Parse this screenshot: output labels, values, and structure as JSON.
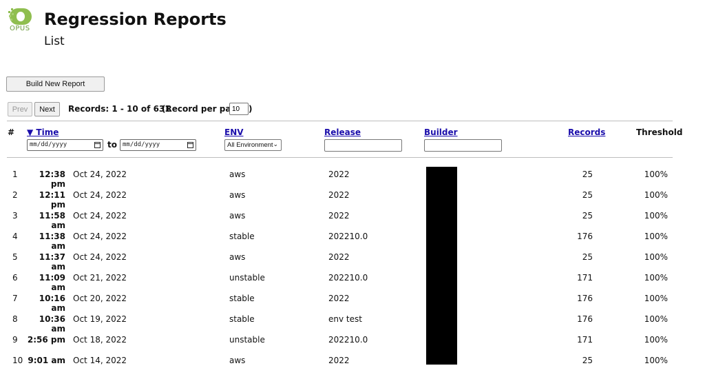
{
  "brand": {
    "logo_text": "OPUS",
    "accent": "#6a9a3a"
  },
  "page": {
    "title": "Regression Reports",
    "subtitle": "List"
  },
  "actions": {
    "build_label": "Build New Report"
  },
  "pagination": {
    "prev_label": "Prev",
    "next_label": "Next",
    "records_label": "Records: 1 - 10 of 631",
    "per_page_label": "(Record per page:",
    "per_page_value": "10",
    "per_page_close": ")"
  },
  "table": {
    "headers": {
      "num": "#",
      "time": "▼ Time",
      "env": "ENV",
      "release": "Release",
      "builder": "Builder",
      "records": "Records",
      "threshold": "Threshold"
    },
    "filters": {
      "date_from_placeholder": "mm/dd/yyyy",
      "to_label": "to",
      "date_to_placeholder": "mm/dd/yyyy",
      "env_selected": "All Environment",
      "release_value": "",
      "builder_value": ""
    },
    "rows": [
      {
        "num": "1",
        "time": "12:38 pm",
        "date": "Oct 24, 2022",
        "env": "aws",
        "release": "2022",
        "records": "25",
        "threshold": "100%"
      },
      {
        "num": "2",
        "time": "12:11 pm",
        "date": "Oct 24, 2022",
        "env": "aws",
        "release": "2022",
        "records": "25",
        "threshold": "100%"
      },
      {
        "num": "3",
        "time": "11:58 am",
        "date": "Oct 24, 2022",
        "env": "aws",
        "release": "2022",
        "records": "25",
        "threshold": "100%"
      },
      {
        "num": "4",
        "time": "11:38 am",
        "date": "Oct 24, 2022",
        "env": "stable",
        "release": "202210.0",
        "records": "176",
        "threshold": "100%"
      },
      {
        "num": "5",
        "time": "11:37 am",
        "date": "Oct 24, 2022",
        "env": "aws",
        "release": "2022",
        "records": "25",
        "threshold": "100%"
      },
      {
        "num": "6",
        "time": "11:09 am",
        "date": "Oct 21, 2022",
        "env": "unstable",
        "release": "202210.0",
        "records": "171",
        "threshold": "100%"
      },
      {
        "num": "7",
        "time": "10:16 am",
        "date": "Oct 20, 2022",
        "env": "stable",
        "release": "2022",
        "records": "176",
        "threshold": "100%"
      },
      {
        "num": "8",
        "time": "10:36 am",
        "date": "Oct 19, 2022",
        "env": "stable",
        "release": "env test",
        "records": "176",
        "threshold": "100%"
      },
      {
        "num": "9",
        "time": "2:56 pm",
        "date": "Oct 18, 2022",
        "env": "unstable",
        "release": "202210.0",
        "records": "171",
        "threshold": "100%"
      },
      {
        "num": "10",
        "time": "9:01 am",
        "date": "Oct 14, 2022",
        "env": "aws",
        "release": "2022",
        "records": "25",
        "threshold": "100%"
      }
    ]
  }
}
